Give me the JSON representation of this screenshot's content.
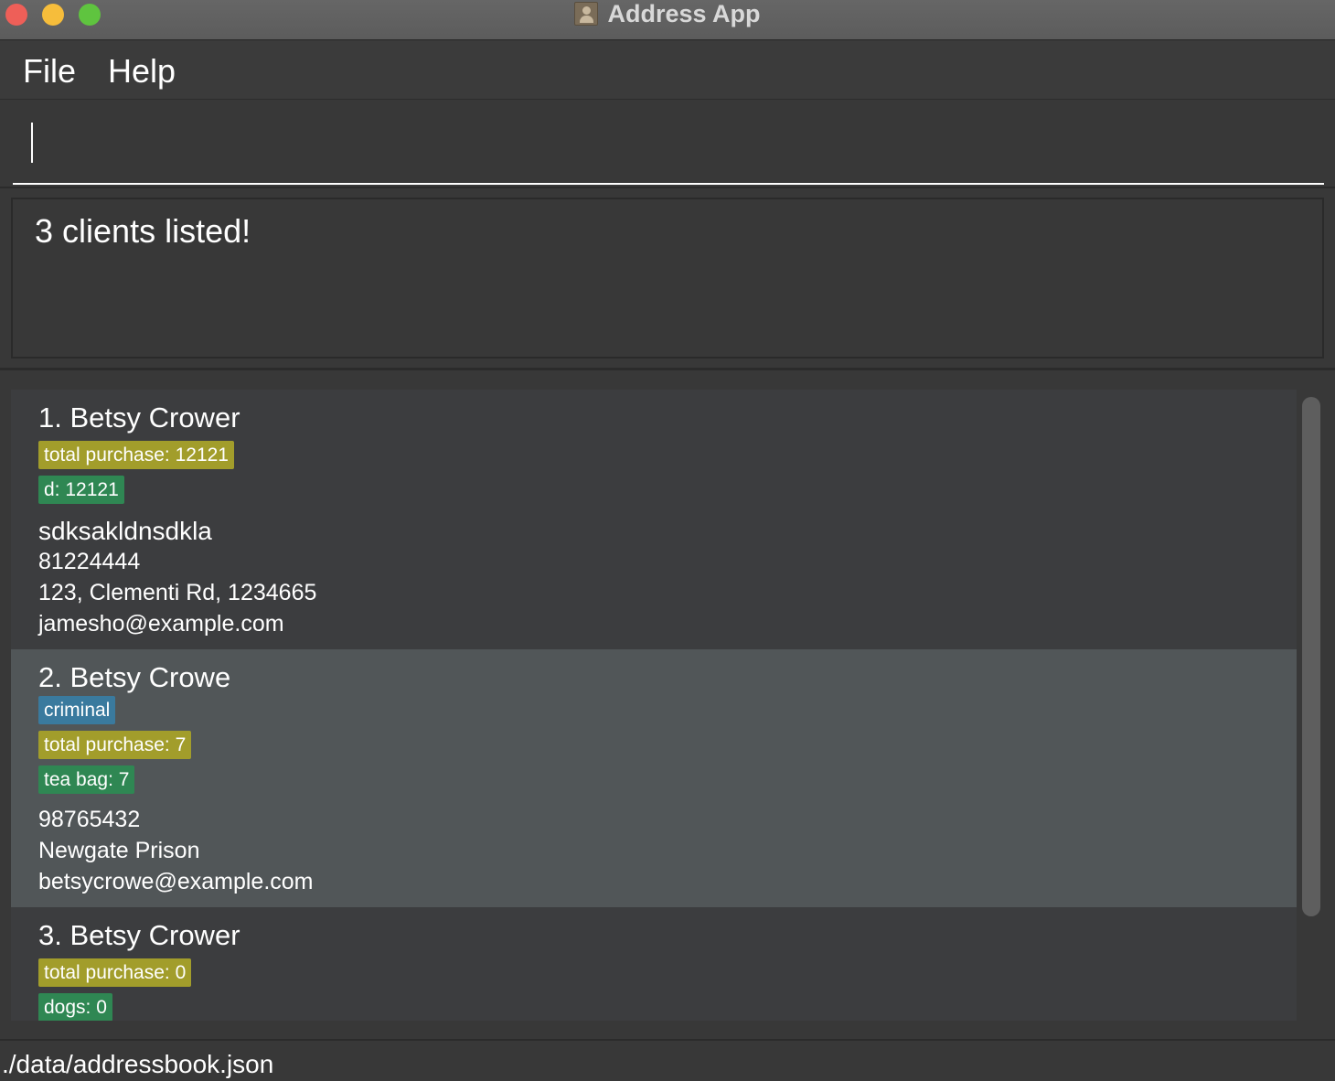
{
  "window": {
    "title": "Address App"
  },
  "menu": {
    "file": "File",
    "help": "Help"
  },
  "command": {
    "value": ""
  },
  "result": {
    "message": "3 clients listed!"
  },
  "clients": [
    {
      "name": "1. Betsy Crower",
      "tags": [
        {
          "label": "total purchase: 12121",
          "kind": "purchase"
        },
        {
          "label": "d: 12121",
          "kind": "item"
        }
      ],
      "description": "sdksakldnsdkla",
      "phone": "81224444",
      "address": "123, Clementi Rd, 1234665",
      "email": "jamesho@example.com"
    },
    {
      "name": "2. Betsy Crowe",
      "selected": true,
      "tags": [
        {
          "label": "criminal",
          "kind": "criminal"
        },
        {
          "label": "total purchase: 7",
          "kind": "purchase"
        },
        {
          "label": "tea bag: 7",
          "kind": "item"
        }
      ],
      "phone": "98765432",
      "address": "Newgate Prison",
      "email": "betsycrowe@example.com"
    },
    {
      "name": "3. Betsy Crower",
      "tags": [
        {
          "label": "total purchase: 0",
          "kind": "purchase"
        },
        {
          "label": "dogs: 0",
          "kind": "item"
        }
      ]
    }
  ],
  "status": {
    "path": "./data/addressbook.json"
  },
  "colors": {
    "purchase_tag": "#a29d2b",
    "item_tag": "#2f8753",
    "criminal_tag": "#3a7a9e",
    "selected_row": "#515658"
  }
}
